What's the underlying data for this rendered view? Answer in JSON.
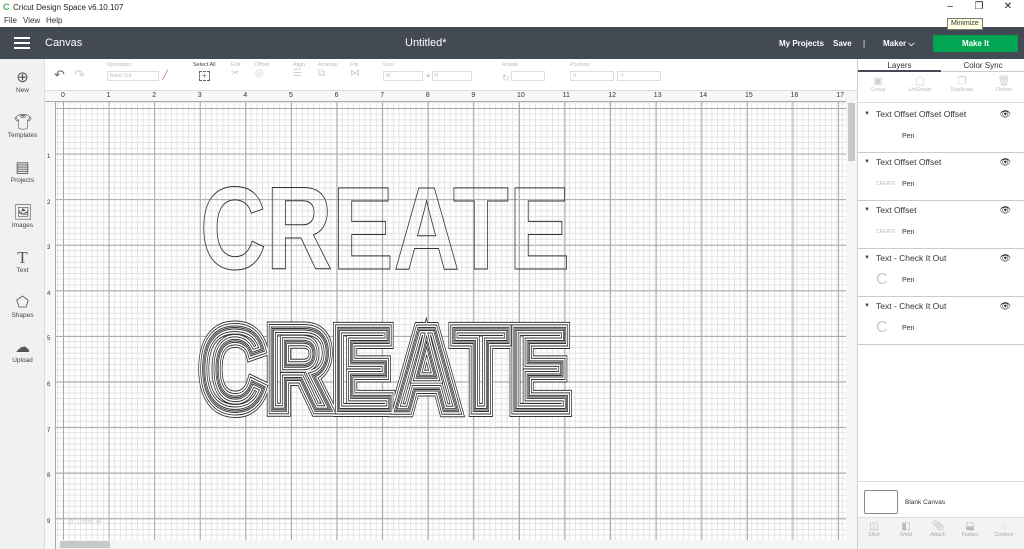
{
  "window": {
    "title": "Cricut Design Space  v6.10.107",
    "minimize_tooltip": "Minimize",
    "controls": {
      "minimize": "–",
      "restore": "❐",
      "close": "✕"
    }
  },
  "menu": [
    "File",
    "View",
    "Help"
  ],
  "header": {
    "canvas_label": "Canvas",
    "doc_title": "Untitled*",
    "my_projects": "My Projects",
    "save": "Save",
    "separator": "|",
    "maker": "Maker",
    "maker_chevron": "⌵",
    "make_it": "Make It",
    "accent": "#00a651",
    "bar_color": "#434a54"
  },
  "toolbar": {
    "operation": {
      "label": "Operation",
      "value": "Basic Cut"
    },
    "select_all": "Select All",
    "edit": "Edit",
    "offset": "Offset",
    "align": "Align",
    "arrange": "Arrange",
    "flip": "Flip",
    "size": {
      "label": "Size",
      "w": "W",
      "h": "H"
    },
    "rotate": "Rotate",
    "position": {
      "label": "Position",
      "x": "X",
      "y": "Y"
    }
  },
  "sidebar": [
    {
      "label": "New",
      "icon": "plus-circle-icon"
    },
    {
      "label": "Templates",
      "icon": "tshirt-icon"
    },
    {
      "label": "Projects",
      "icon": "notebook-icon"
    },
    {
      "label": "Images",
      "icon": "image-icon"
    },
    {
      "label": "Text",
      "icon": "text-t-icon"
    },
    {
      "label": "Shapes",
      "icon": "shapes-icon"
    },
    {
      "label": "Upload",
      "icon": "cloud-upload-icon"
    }
  ],
  "ruler": {
    "top": [
      "0",
      "1",
      "2",
      "3",
      "4",
      "5",
      "6",
      "7",
      "8",
      "9",
      "10",
      "11",
      "12",
      "13",
      "14",
      "15",
      "16",
      "17"
    ],
    "left": [
      "1",
      "2",
      "3",
      "4",
      "5",
      "6",
      "7",
      "8",
      "9"
    ]
  },
  "canvas": {
    "zoom": "100%",
    "words": [
      "CREATE",
      "CREATE"
    ]
  },
  "panel": {
    "tabs": [
      "Layers",
      "Color Sync"
    ],
    "actions": [
      "Group",
      "UnGroup",
      "Duplicate",
      "Delete"
    ],
    "layers": [
      {
        "name": "Text Offset Offset Offset",
        "type": "Pen",
        "thumb": ""
      },
      {
        "name": "Text Offset Offset",
        "type": "Pen",
        "thumb": "CREATE"
      },
      {
        "name": "Text Offset",
        "type": "Pen",
        "thumb": "CREATE"
      },
      {
        "name": "Text - Check It Out",
        "type": "Pen",
        "thumb": "C"
      },
      {
        "name": "Text - Check It Out",
        "type": "Pen",
        "thumb": "C"
      }
    ],
    "blank_canvas": "Blank Canvas",
    "bottom_actions": [
      "Slice",
      "Weld",
      "Attach",
      "Flatten",
      "Contour"
    ]
  }
}
